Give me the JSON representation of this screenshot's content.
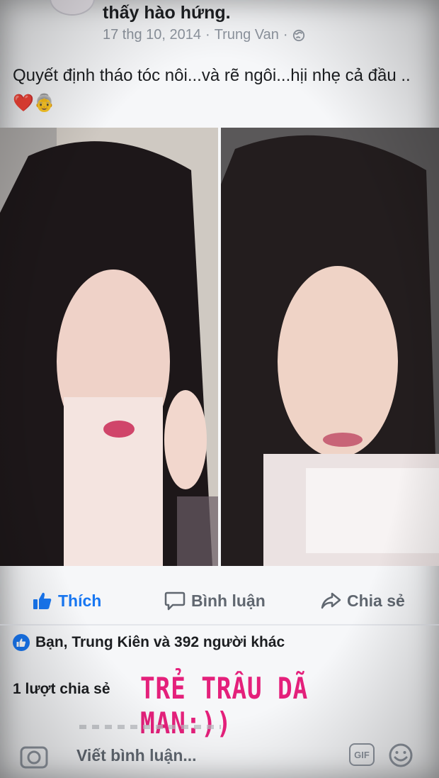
{
  "post": {
    "header_text": "thấy hào hứng.",
    "date": "17 thg 10, 2014",
    "separator": "·",
    "author": "Trung Van",
    "separator2": "·",
    "body_line": "Quyết định tháo tóc nôi...và rẽ ngôi...hịi nhẹ cả đầu ..",
    "emoji_heart": "❤️",
    "emoji_person": "👵"
  },
  "actions": {
    "like": "Thích",
    "comment": "Bình luận",
    "share": "Chia sẻ"
  },
  "stats": {
    "reactions": "Bạn, Trung Kiên và 392 người khác",
    "shares": "1 lượt chia sẻ"
  },
  "overlay_caption": "TRẺ TRÂU DÃ MAN:))",
  "comment_bar": {
    "placeholder": "Viết bình luận...",
    "gif_label": "GIF"
  },
  "colors": {
    "accent": "#1877f2",
    "caption": "#e4207b",
    "muted": "#606770"
  },
  "icons": [
    "globe-icon",
    "like-icon",
    "comment-icon",
    "share-icon",
    "camera-icon",
    "gif-icon",
    "smiley-icon"
  ]
}
